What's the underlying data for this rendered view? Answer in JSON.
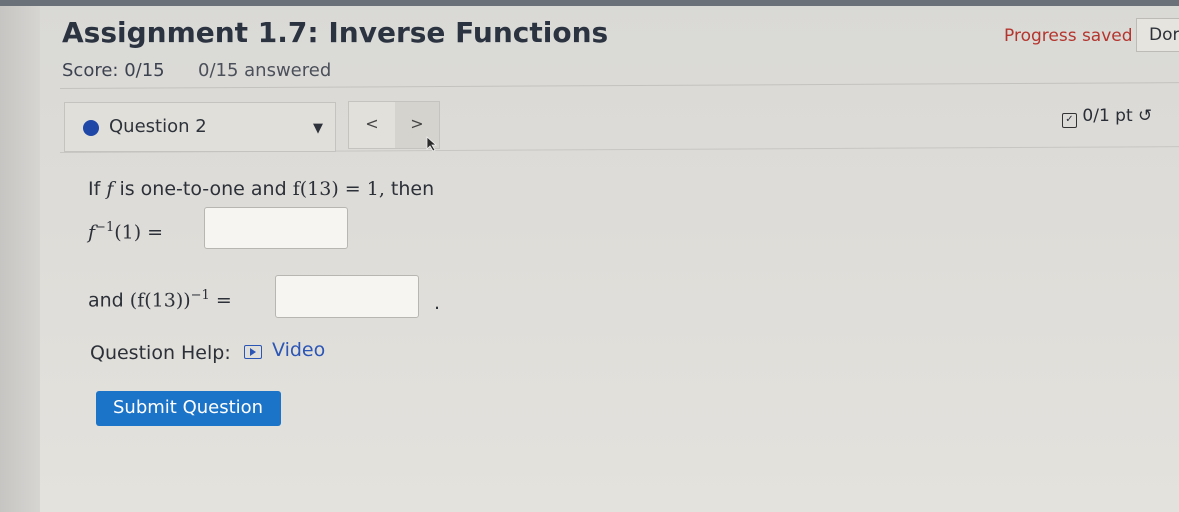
{
  "header": {
    "title": "Assignment 1.7: Inverse Functions",
    "score": "Score: 0/15",
    "answered": "0/15 answered",
    "progress": "Progress saved",
    "done_label": "Dor"
  },
  "question_nav": {
    "selected": "Question 2",
    "prev_label": "<",
    "next_label": ">",
    "points": "0/1 pt"
  },
  "question": {
    "intro_text": "If",
    "f_var": "f",
    "intro_mid": "is one-to-one and",
    "intro_eq": "f(13) = 1,",
    "intro_then": "then",
    "finv_base": "f",
    "finv_sup": "−1",
    "finv_arg": "(1) =",
    "and_label": "and",
    "paren_expr": "(f(13))",
    "paren_sup": "−1",
    "paren_eq": "=",
    "period": ".",
    "help_label": "Question Help:",
    "video_label": "Video",
    "submit_label": "Submit Question"
  },
  "colors": {
    "accent": "#1c74c9",
    "saved_red": "#b4352d",
    "link_blue": "#2c56b5"
  }
}
